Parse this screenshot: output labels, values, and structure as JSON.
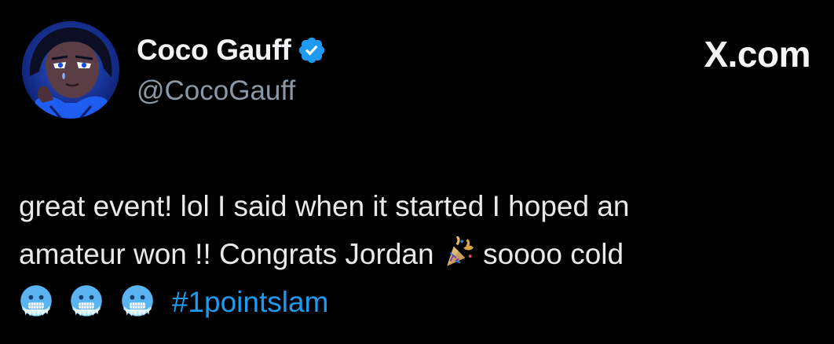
{
  "author": {
    "display_name": "Coco Gauff",
    "handle": "@CocoGauff",
    "verified": true,
    "verified_color": "#1d9bf0"
  },
  "brand": {
    "label": "X.com"
  },
  "post": {
    "line1": "great event! lol I said when it started I hoped an",
    "line2_part1": "amateur won !! Congrats Jordan",
    "line2_emoji": "party-popper-emoji",
    "line2_part2": " soooo cold",
    "line3_emojis": [
      "cold-face-emoji",
      "cold-face-emoji",
      "cold-face-emoji"
    ],
    "hashtag": "#1pointslam"
  },
  "colors": {
    "background": "#000000",
    "text": "#e7e9ea",
    "secondary_text": "#8b98a5",
    "link": "#1d9bf0"
  }
}
